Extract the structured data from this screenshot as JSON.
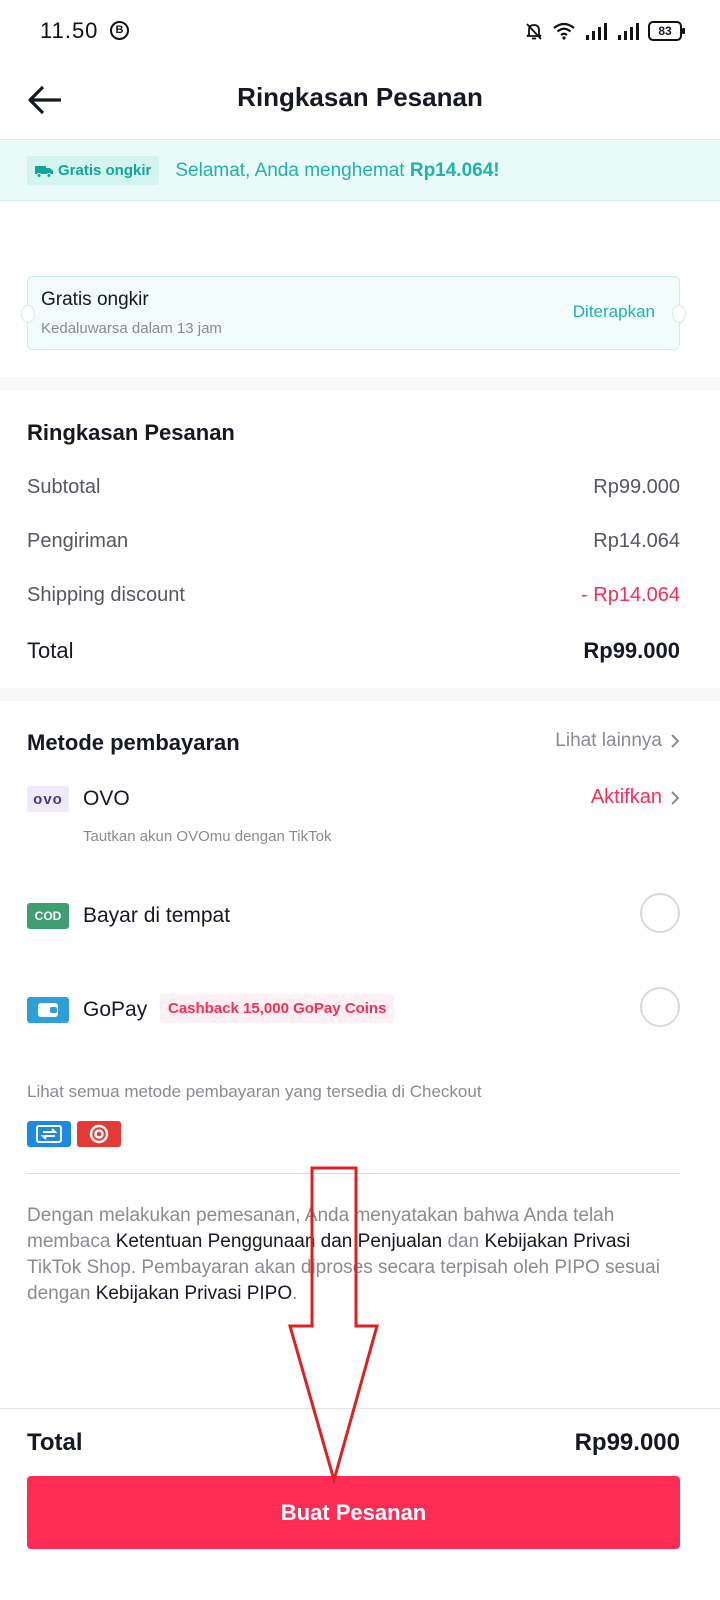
{
  "status_bar": {
    "time": "11.50",
    "b_badge": "B",
    "battery": "83"
  },
  "header": {
    "title": "Ringkasan Pesanan"
  },
  "savings_banner": {
    "chip_label": "Gratis ongkir",
    "text_prefix": "Selamat, Anda menghemat ",
    "amount": "Rp14.064!"
  },
  "voucher": {
    "title": "Gratis ongkir",
    "expiry": "Kedaluwarsa dalam 13 jam",
    "status": "Diterapkan"
  },
  "summary": {
    "title": "Ringkasan Pesanan",
    "rows": [
      {
        "label": "Subtotal",
        "value": "Rp99.000"
      },
      {
        "label": "Pengiriman",
        "value": "Rp14.064"
      },
      {
        "label": "Shipping discount",
        "value": "- Rp14.064"
      },
      {
        "label": "Total",
        "value": "Rp99.000"
      }
    ]
  },
  "payment": {
    "title": "Metode pembayaran",
    "see_more": "Lihat lainnya",
    "methods": [
      {
        "logo": "ovo",
        "name": "OVO",
        "subtitle": "Tautkan akun OVOmu dengan TikTok",
        "action": "Aktifkan"
      },
      {
        "logo": "COD",
        "name": "Bayar di tempat"
      },
      {
        "logo": "gopay-wallet",
        "name": "GoPay",
        "tag": "Cashback 15,000 GoPay Coins"
      }
    ],
    "all_methods_text": "Lihat semua metode pembayaran yang tersedia di Checkout"
  },
  "terms": {
    "p1": "Dengan melakukan pemesanan, Anda menyatakan bahwa Anda telah membaca ",
    "link1": "Ketentuan Penggunaan dan Penjualan",
    "p2": " dan ",
    "link2": "Kebijakan Privasi",
    "p3": " TikTok Shop. Pembayaran akan diproses secara terpisah oleh PIPO sesuai dengan ",
    "link3": "Kebijakan Privasi PIPO",
    "p4": "."
  },
  "footer": {
    "total_label": "Total",
    "total_value": "Rp99.000",
    "button_label": "Buat Pesanan"
  },
  "colors": {
    "accent": "#fe2c55",
    "teal": "#1fb3a6",
    "annotation": "#e02020"
  }
}
